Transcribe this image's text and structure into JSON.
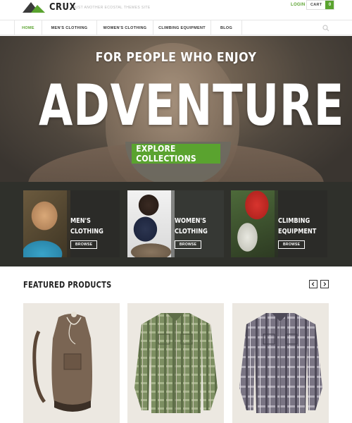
{
  "brand": {
    "name": "CRUX",
    "tagline": "JUST ANOTHER ECOSTAL THEMES SITE",
    "accent_color": "#5aa32f"
  },
  "header": {
    "login_label": "LOGIN",
    "cart_label": "CART",
    "cart_count": "0"
  },
  "nav": {
    "items": [
      {
        "label": "HOME",
        "active": true
      },
      {
        "label": "MEN'S CLOTHING",
        "active": false
      },
      {
        "label": "WOMEN'S CLOTHING",
        "active": false
      },
      {
        "label": "CLIMBING EQUIPMENT",
        "active": false
      },
      {
        "label": "BLOG",
        "active": false
      }
    ],
    "search_icon": "search-icon"
  },
  "hero": {
    "subtitle": "FOR PEOPLE WHO ENJOY",
    "title": "ADVENTURE",
    "cta_label": "EXPLORE COLLECTIONS"
  },
  "collections": [
    {
      "title_line1": "MEN'S",
      "title_line2": "CLOTHING",
      "button_label": "BROWSE"
    },
    {
      "title_line1": "WOMEN'S",
      "title_line2": "CLOTHING",
      "button_label": "BROWSE"
    },
    {
      "title_line1": "CLIMBING",
      "title_line2": "EQUIPMENT",
      "button_label": "BROWSE"
    }
  ],
  "featured": {
    "title": "FEATURED PRODUCTS",
    "prev_icon": "chevron-left-icon",
    "next_icon": "chevron-right-icon",
    "products": [
      {
        "image": "backpack"
      },
      {
        "image": "green-plaid-shirt"
      },
      {
        "image": "grey-plaid-shirt"
      }
    ]
  }
}
